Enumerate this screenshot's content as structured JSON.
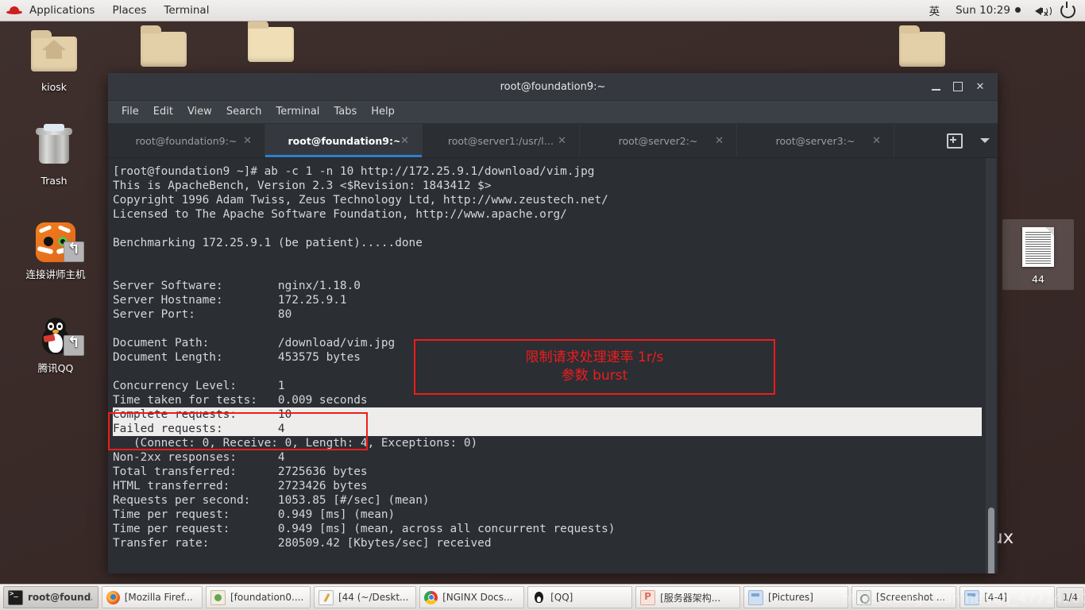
{
  "top_panel": {
    "logo": "redhat-logo",
    "menus": [
      "Applications",
      "Places",
      "Terminal"
    ],
    "input_method": "英",
    "clock": "Sun 10:29",
    "volume_icon": "speaker-muted-icon",
    "power_icon": "power-icon"
  },
  "desktop": {
    "icons": [
      {
        "label": "kiosk",
        "type": "folder-home"
      },
      {
        "label": "Trash",
        "type": "trash"
      },
      {
        "label": "连接讲师主机",
        "type": "tiger-shortcut"
      },
      {
        "label": "腾讯QQ",
        "type": "qq-shortcut"
      },
      {
        "label": "44",
        "type": "document",
        "selected": true
      }
    ],
    "background_text": "ux"
  },
  "terminal": {
    "title": "root@foundation9:~",
    "window_buttons": {
      "minimize": "–",
      "maximize": "□",
      "close": "✕"
    },
    "menubar": [
      "File",
      "Edit",
      "View",
      "Search",
      "Terminal",
      "Tabs",
      "Help"
    ],
    "tabs": [
      {
        "label": "root@foundation9:~",
        "active": false
      },
      {
        "label": "root@foundation9:~",
        "active": true
      },
      {
        "label": "root@server1:/usr/l…",
        "active": false
      },
      {
        "label": "root@server2:~",
        "active": false
      },
      {
        "label": "root@server3:~",
        "active": false
      }
    ],
    "tab_tools": {
      "new_tab": "new-tab-icon",
      "tab_list": "chevron-down-icon"
    },
    "lines": [
      {
        "t": "[root@foundation9 ~]# ab -c 1 -n 10 http://172.25.9.1/download/vim.jpg"
      },
      {
        "t": "This is ApacheBench, Version 2.3 <$Revision: 1843412 $>"
      },
      {
        "t": "Copyright 1996 Adam Twiss, Zeus Technology Ltd, http://www.zeustech.net/"
      },
      {
        "t": "Licensed to The Apache Software Foundation, http://www.apache.org/"
      },
      {
        "t": ""
      },
      {
        "t": "Benchmarking 172.25.9.1 (be patient).....done"
      },
      {
        "t": ""
      },
      {
        "t": ""
      },
      {
        "t": "Server Software:        nginx/1.18.0"
      },
      {
        "t": "Server Hostname:        172.25.9.1"
      },
      {
        "t": "Server Port:            80"
      },
      {
        "t": ""
      },
      {
        "t": "Document Path:          /download/vim.jpg"
      },
      {
        "t": "Document Length:        453575 bytes"
      },
      {
        "t": ""
      },
      {
        "t": "Concurrency Level:      1"
      },
      {
        "t": "Time taken for tests:   0.009 seconds"
      },
      {
        "t": "Complete requests:      10",
        "selected": true
      },
      {
        "t": "Failed requests:        4",
        "selected": true
      },
      {
        "t": "   (Connect: 0, Receive: 0, Length: 4, Exceptions: 0)"
      },
      {
        "t": "Non-2xx responses:      4"
      },
      {
        "t": "Total transferred:      2725636 bytes"
      },
      {
        "t": "HTML transferred:       2723426 bytes"
      },
      {
        "t": "Requests per second:    1053.85 [#/sec] (mean)"
      },
      {
        "t": "Time per request:       0.949 [ms] (mean)"
      },
      {
        "t": "Time per request:       0.949 [ms] (mean, across all concurrent requests)"
      },
      {
        "t": "Transfer rate:          280509.42 [Kbytes/sec] received"
      }
    ]
  },
  "annotations": {
    "note_line1": "限制请求处理速率 1r/s",
    "note_line2": "参数 burst",
    "color": "#f01c1c"
  },
  "taskbar": {
    "items": [
      {
        "label": "root@found...",
        "icon": "terminal-icon",
        "active": true
      },
      {
        "label": "[Mozilla Firef...",
        "icon": "firefox-icon",
        "active": false
      },
      {
        "label": "[foundation0....",
        "icon": "file-manager-icon",
        "active": false
      },
      {
        "label": "[44 (~/Deskt...",
        "icon": "text-editor-icon",
        "active": false
      },
      {
        "label": "[NGINX Docs...",
        "icon": "chrome-icon",
        "active": false
      },
      {
        "label": "[QQ]",
        "icon": "qq-icon",
        "active": false
      },
      {
        "label": "[服务器架构...",
        "icon": "pdf-icon",
        "active": false
      },
      {
        "label": "[Pictures]",
        "icon": "pictures-icon",
        "active": false
      },
      {
        "label": "[Screenshot ...",
        "icon": "screenshot-icon",
        "active": false
      },
      {
        "label": "[4-4]",
        "icon": "pictures-icon",
        "active": false
      }
    ],
    "workspace_indicator": "1/4"
  },
  "watermark": "https://blog.csdn.net/qq_47714200"
}
